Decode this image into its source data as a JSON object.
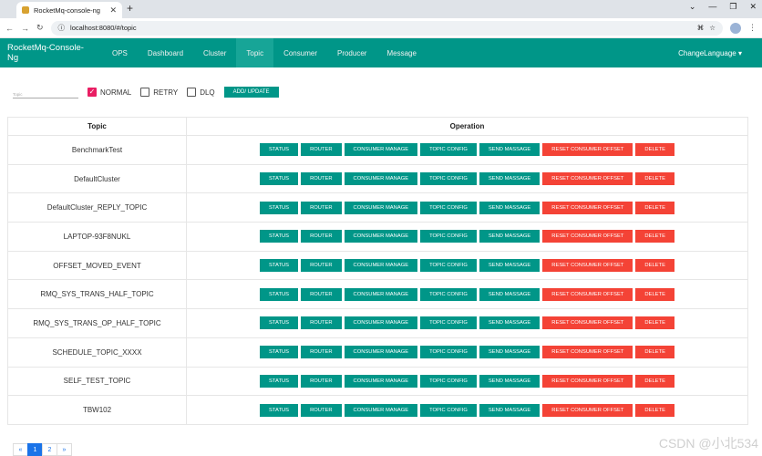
{
  "browser": {
    "tab_title": "RocketMq-console-ng",
    "url": "localhost:8080/#/topic"
  },
  "nav": {
    "brand": "RocketMq-Console-Ng",
    "items": [
      "OPS",
      "Dashboard",
      "Cluster",
      "Topic",
      "Consumer",
      "Producer",
      "Message"
    ],
    "active": "Topic",
    "language": "ChangeLanguage ▾"
  },
  "filters": {
    "topic_placeholder": "Topic",
    "normal": "NORMAL",
    "retry": "RETRY",
    "dlq": "DLQ",
    "add_update": "ADD/ UPDATE"
  },
  "table": {
    "headers": [
      "Topic",
      "Operation"
    ],
    "rows": [
      "BenchmarkTest",
      "DefaultCluster",
      "DefaultCluster_REPLY_TOPIC",
      "LAPTOP-93F8NUKL",
      "OFFSET_MOVED_EVENT",
      "RMQ_SYS_TRANS_HALF_TOPIC",
      "RMQ_SYS_TRANS_OP_HALF_TOPIC",
      "SCHEDULE_TOPIC_XXXX",
      "SELF_TEST_TOPIC",
      "TBW102"
    ],
    "actions": [
      "STATUS",
      "ROUTER",
      "CONSUMER MANAGE",
      "TOPIC CONFIG",
      "SEND MASSAGE",
      "RESET CONSUMER OFFSET",
      "DELETE"
    ]
  },
  "pagination": {
    "prev": "«",
    "pages": [
      "1",
      "2"
    ],
    "current": "1",
    "next": "»"
  },
  "watermark": "CSDN @小北534",
  "colors": {
    "primary": "#009688",
    "danger": "#f44336",
    "checkbox": "#e91e63"
  }
}
